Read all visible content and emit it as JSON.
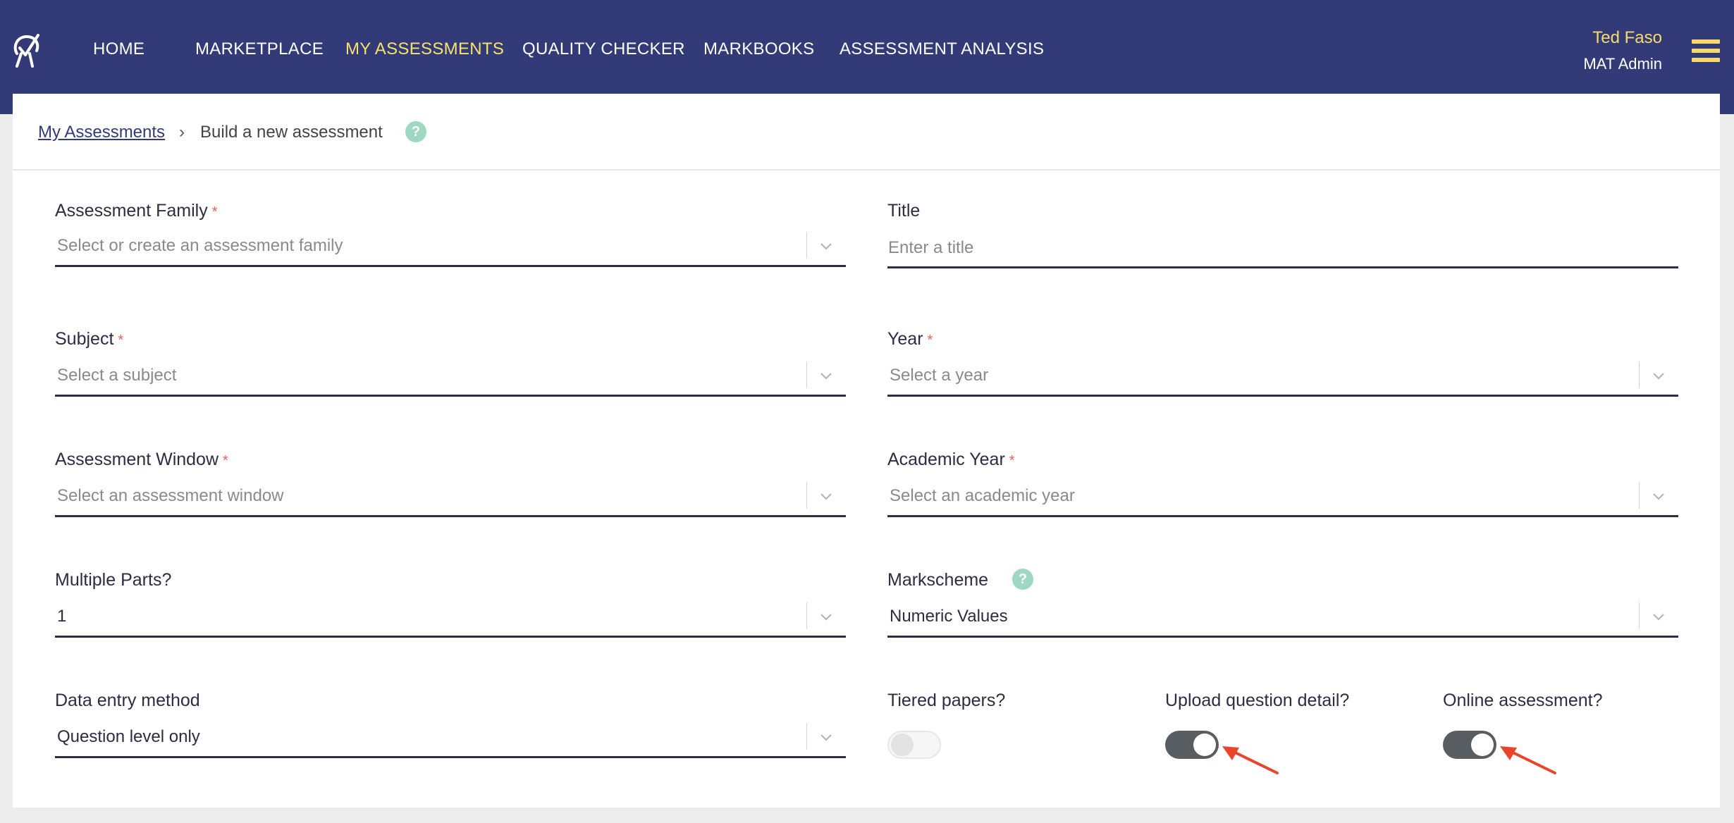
{
  "nav": {
    "items": [
      {
        "label": "HOME",
        "active": false
      },
      {
        "label": "MARKETPLACE",
        "active": false
      },
      {
        "label": "MY ASSESSMENTS",
        "active": true
      },
      {
        "label": "QUALITY CHECKER",
        "active": false
      },
      {
        "label": "MARKBOOKS",
        "active": false
      },
      {
        "label": "ASSESSMENT ANALYSIS",
        "active": false
      }
    ],
    "user_name": "Ted Faso",
    "user_role": "MAT Admin"
  },
  "breadcrumb": {
    "parent": "My Assessments",
    "separator": "›",
    "current": "Build a new assessment"
  },
  "form": {
    "assessment_family": {
      "label": "Assessment Family",
      "placeholder": "Select or create an assessment family",
      "required": true
    },
    "title": {
      "label": "Title",
      "placeholder": "Enter a title",
      "value": ""
    },
    "subject": {
      "label": "Subject",
      "placeholder": "Select a subject",
      "required": true
    },
    "year": {
      "label": "Year",
      "placeholder": "Select a year",
      "required": true
    },
    "assessment_window": {
      "label": "Assessment Window",
      "placeholder": "Select an assessment window",
      "required": true
    },
    "academic_year": {
      "label": "Academic Year",
      "placeholder": "Select an academic year",
      "required": true
    },
    "multiple_parts": {
      "label": "Multiple Parts?",
      "value": "1"
    },
    "markscheme": {
      "label": "Markscheme",
      "value": "Numeric Values"
    },
    "data_entry_method": {
      "label": "Data entry method",
      "value": "Question level only"
    },
    "tiered_papers": {
      "label": "Tiered papers?",
      "checked": false
    },
    "upload_question_detail": {
      "label": "Upload question detail?",
      "checked": true
    },
    "online_assessment": {
      "label": "Online assessment?",
      "checked": true
    }
  },
  "help_icon_glyph": "?",
  "required_marker": "*",
  "colors": {
    "navbar": "#323b78",
    "nav_active": "#f7e26b",
    "help_icon": "#9ed8c0",
    "required": "#e8605a",
    "toggle_on": "#575d61",
    "annotation_arrow": "#e8452c"
  }
}
